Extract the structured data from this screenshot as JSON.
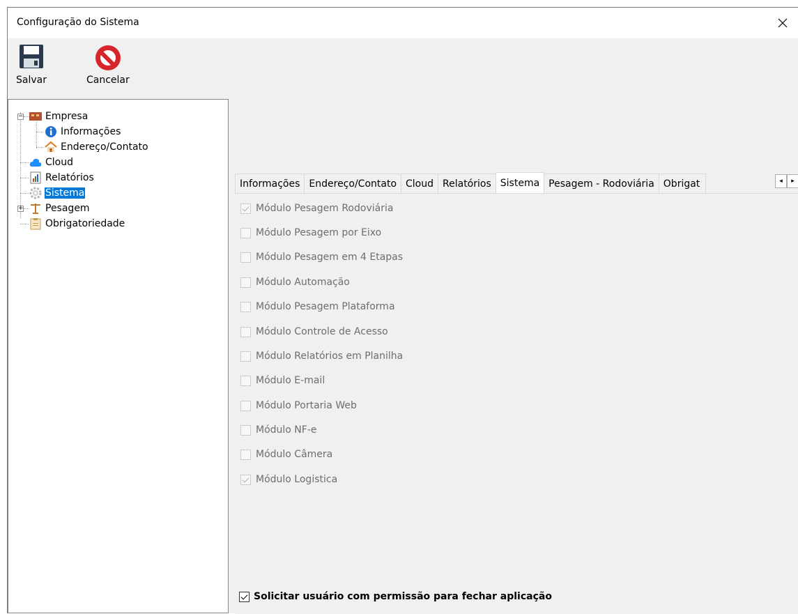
{
  "window": {
    "title": "Configuração do Sistema",
    "close_glyph": "✕"
  },
  "toolbar": {
    "save_label": "Salvar",
    "cancel_label": "Cancelar",
    "save_icon": "floppy-disk-icon",
    "cancel_icon": "cancel-icon"
  },
  "tree": {
    "empresa": "Empresa",
    "informacoes": "Informações",
    "endereco": "Endereço/Contato",
    "cloud": "Cloud",
    "relatorios": "Relatórios",
    "sistema": "Sistema",
    "pesagem": "Pesagem",
    "obrigatoriedade": "Obrigatoriedade",
    "selected": "Sistema"
  },
  "tabs": {
    "items": [
      "Informações",
      "Endereço/Contato",
      "Cloud",
      "Relatórios",
      "Sistema",
      "Pesagem - Rodoviária",
      "Obrigat"
    ],
    "active": "Sistema",
    "scroll_left": "◂",
    "scroll_right": "▸"
  },
  "modules": [
    {
      "label": "Módulo Pesagem Rodoviária",
      "checked": true
    },
    {
      "label": "Módulo Pesagem por Eixo",
      "checked": false
    },
    {
      "label": "Módulo Pesagem em 4 Etapas",
      "checked": false
    },
    {
      "label": "Módulo Automação",
      "checked": false
    },
    {
      "label": "Módulo Pesagem Plataforma",
      "checked": false
    },
    {
      "label": "Módulo Controle de Acesso",
      "checked": false
    },
    {
      "label": "Módulo Relatórios em Planilha",
      "checked": false
    },
    {
      "label": "Módulo E-mail",
      "checked": false
    },
    {
      "label": "Módulo Portaria Web",
      "checked": false
    },
    {
      "label": "Módulo NF-e",
      "checked": false
    },
    {
      "label": "Módulo Câmera",
      "checked": false
    },
    {
      "label": "Módulo Logistica",
      "checked": true
    }
  ],
  "close_permission": {
    "label": "Solicitar usuário com permissão para fechar aplicação",
    "checked": true
  },
  "colors": {
    "selection": "#0078d7",
    "disabled_text": "#6d6d6d"
  }
}
